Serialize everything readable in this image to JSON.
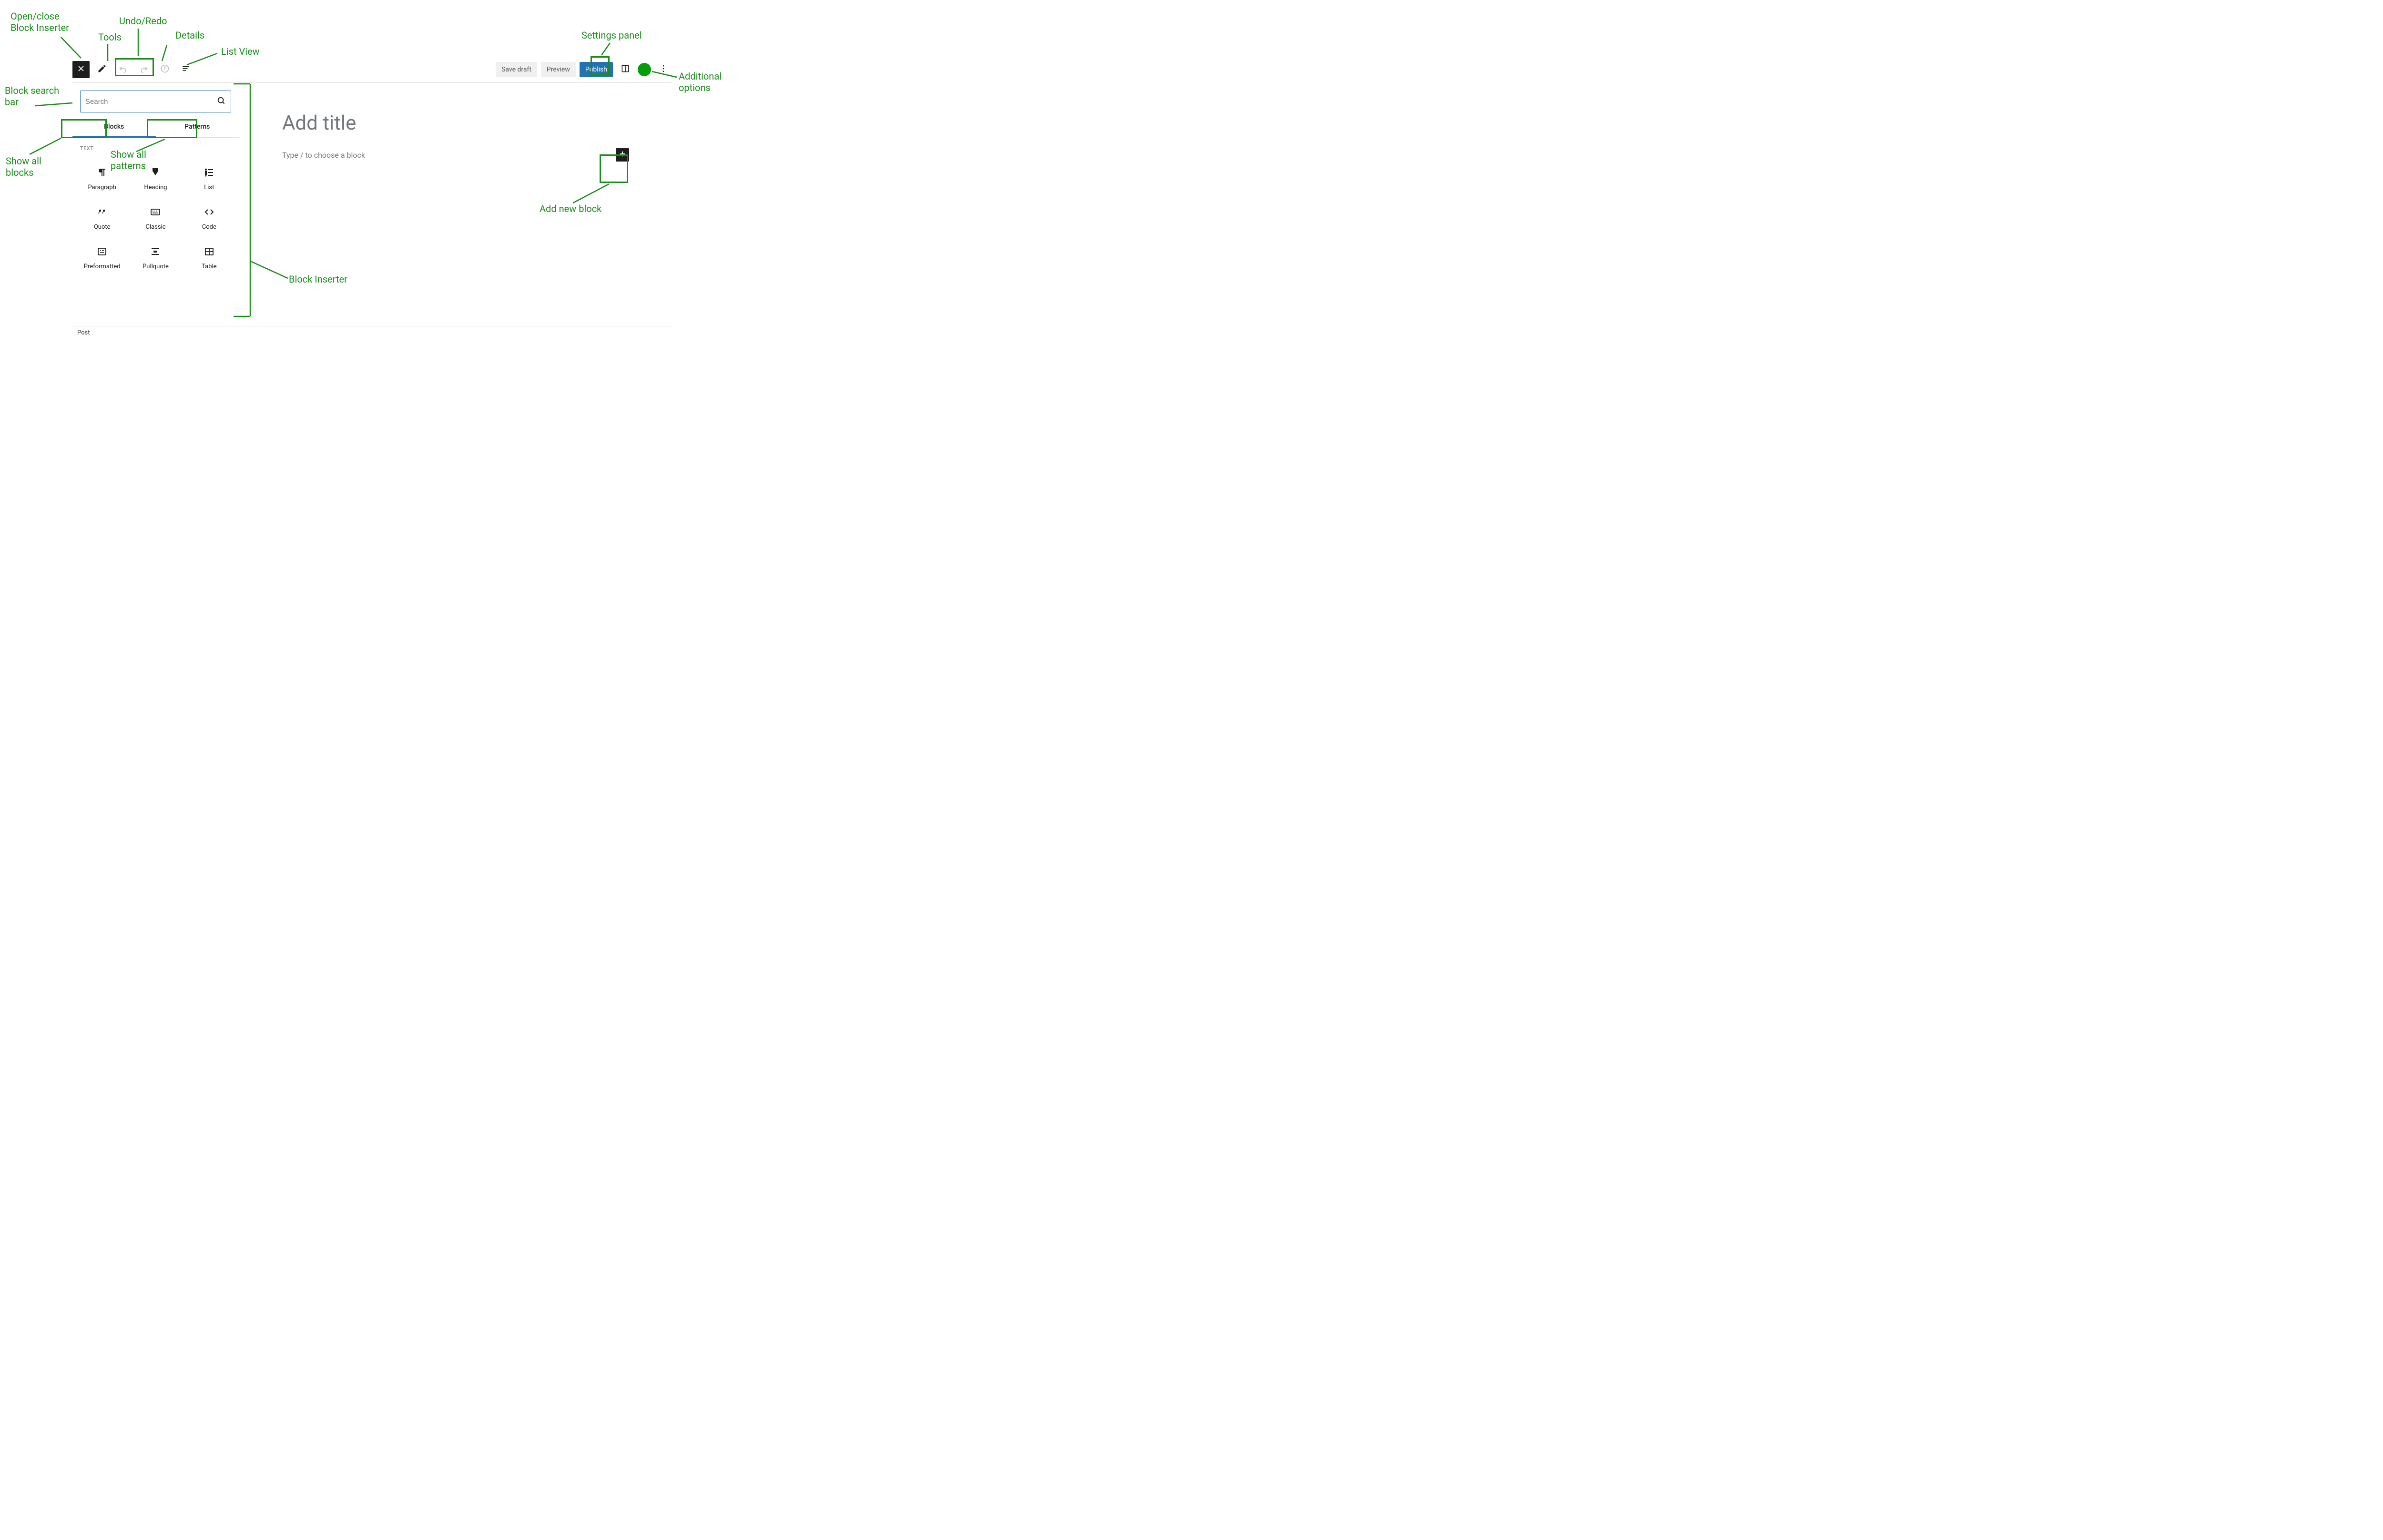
{
  "toolbar": {
    "save_draft": "Save draft",
    "preview": "Preview",
    "publish": "Publish"
  },
  "inserter": {
    "search_placeholder": "Search",
    "tab_blocks": "Blocks",
    "tab_patterns": "Patterns",
    "category": "TEXT",
    "blocks": [
      {
        "label": "Paragraph"
      },
      {
        "label": "Heading"
      },
      {
        "label": "List"
      },
      {
        "label": "Quote"
      },
      {
        "label": "Classic"
      },
      {
        "label": "Code"
      },
      {
        "label": "Preformatted"
      },
      {
        "label": "Pullquote"
      },
      {
        "label": "Table"
      }
    ]
  },
  "canvas": {
    "title_placeholder": "Add title",
    "body_placeholder": "Type / to choose a block"
  },
  "footer": {
    "breadcrumb": "Post"
  },
  "annotations": {
    "open_close_inserter": "Open/close\nBlock Inserter",
    "tools": "Tools",
    "undo_redo": "Undo/Redo",
    "details": "Details",
    "list_view": "List View",
    "block_search_bar": "Block search\nbar",
    "show_all_blocks": "Show all\nblocks",
    "show_all_patterns": "Show all\npatterns",
    "block_inserter": "Block Inserter",
    "settings_panel": "Settings panel",
    "additional_options": "Additional\noptions",
    "add_new_block": "Add new block"
  }
}
